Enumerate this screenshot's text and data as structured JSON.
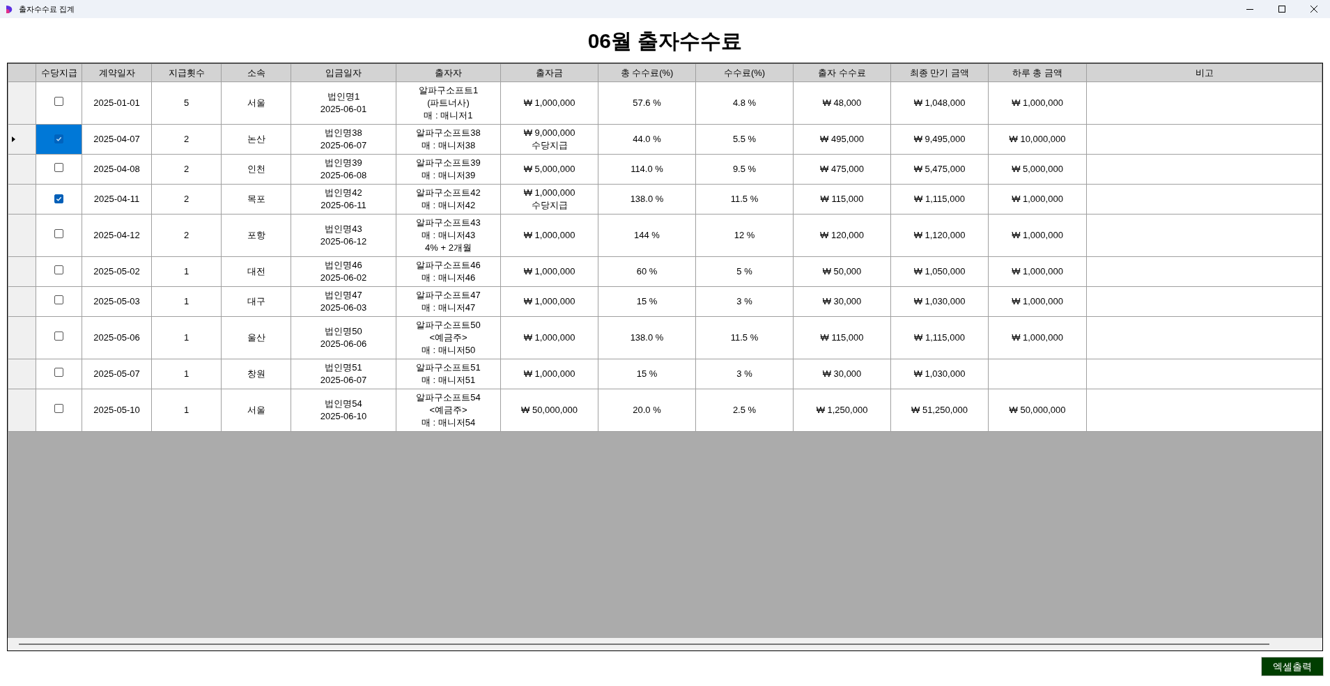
{
  "window": {
    "title": "출자수수료 집계"
  },
  "heading": "06월 출자수수료",
  "table": {
    "columns": [
      "수당지급",
      "계약일자",
      "지급횟수",
      "소속",
      "입금일자",
      "출자자",
      "출자금",
      "총 수수료(%)",
      "수수료(%)",
      "출자 수수료",
      "최종 만기 금액",
      "하루 총 금액",
      "비고"
    ],
    "rows": [
      {
        "selected": false,
        "checked": false,
        "contract_date": "2025-01-01",
        "count": "5",
        "branch": "서울",
        "deposit": "법인명1\n2025-06-01",
        "investor": "알파구소프트1\n(파트너사)\n매 : 매니저1",
        "amount": "₩ 1,000,000",
        "total_fee": "57.6 %",
        "fee": "4.8 %",
        "invest_fee": "₩ 48,000",
        "final_amount": "₩ 1,048,000",
        "daily_total": "₩ 1,000,000"
      },
      {
        "selected": true,
        "checked": true,
        "contract_date": "2025-04-07",
        "count": "2",
        "branch": "논산",
        "deposit": "법인명38\n2025-06-07",
        "investor": "알파구소프트38\n매 : 매니저38",
        "amount": "₩ 9,000,000\n수당지급",
        "total_fee": "44.0 %",
        "fee": "5.5 %",
        "invest_fee": "₩ 495,000",
        "final_amount": "₩ 9,495,000",
        "daily_total": "₩ 10,000,000"
      },
      {
        "selected": false,
        "checked": false,
        "contract_date": "2025-04-08",
        "count": "2",
        "branch": "인천",
        "deposit": "법인명39\n2025-06-08",
        "investor": "알파구소프트39\n매 : 매니저39",
        "amount": "₩ 5,000,000",
        "total_fee": "114.0 %",
        "fee": "9.5 %",
        "invest_fee": "₩ 475,000",
        "final_amount": "₩ 5,475,000",
        "daily_total": "₩ 5,000,000"
      },
      {
        "selected": false,
        "checked": true,
        "contract_date": "2025-04-11",
        "count": "2",
        "branch": "목포",
        "deposit": "법인명42\n2025-06-11",
        "investor": "알파구소프트42\n매 : 매니저42",
        "amount": "₩ 1,000,000\n수당지급",
        "total_fee": "138.0 %",
        "fee": "11.5 %",
        "invest_fee": "₩ 115,000",
        "final_amount": "₩ 1,115,000",
        "daily_total": "₩ 1,000,000"
      },
      {
        "selected": false,
        "checked": false,
        "contract_date": "2025-04-12",
        "count": "2",
        "branch": "포항",
        "deposit": "법인명43\n2025-06-12",
        "investor": "알파구소프트43\n매 : 매니저43\n4% + 2개월",
        "amount": "₩ 1,000,000",
        "total_fee": "144 %",
        "fee": "12 %",
        "invest_fee": "₩ 120,000",
        "final_amount": "₩ 1,120,000",
        "daily_total": "₩ 1,000,000"
      },
      {
        "selected": false,
        "checked": false,
        "contract_date": "2025-05-02",
        "count": "1",
        "branch": "대전",
        "deposit": "법인명46\n2025-06-02",
        "investor": "알파구소프트46\n매 : 매니저46",
        "amount": "₩ 1,000,000",
        "total_fee": "60 %",
        "fee": "5 %",
        "invest_fee": "₩ 50,000",
        "final_amount": "₩ 1,050,000",
        "daily_total": "₩ 1,000,000"
      },
      {
        "selected": false,
        "checked": false,
        "contract_date": "2025-05-03",
        "count": "1",
        "branch": "대구",
        "deposit": "법인명47\n2025-06-03",
        "investor": "알파구소프트47\n매 : 매니저47",
        "amount": "₩ 1,000,000",
        "total_fee": "15 %",
        "fee": "3 %",
        "invest_fee": "₩ 30,000",
        "final_amount": "₩ 1,030,000",
        "daily_total": "₩ 1,000,000"
      },
      {
        "selected": false,
        "checked": false,
        "contract_date": "2025-05-06",
        "count": "1",
        "branch": "울산",
        "deposit": "법인명50\n2025-06-06",
        "investor": "알파구소프트50\n<예금주>\n매 : 매니저50",
        "amount": "₩ 1,000,000",
        "total_fee": "138.0 %",
        "fee": "11.5 %",
        "invest_fee": "₩ 115,000",
        "final_amount": "₩ 1,115,000",
        "daily_total": "₩ 1,000,000"
      },
      {
        "selected": false,
        "checked": false,
        "contract_date": "2025-05-07",
        "count": "1",
        "branch": "창원",
        "deposit": "법인명51\n2025-06-07",
        "investor": "알파구소프트51\n매 : 매니저51",
        "amount": "₩ 1,000,000",
        "total_fee": "15 %",
        "fee": "3 %",
        "invest_fee": "₩ 30,000",
        "final_amount": "₩ 1,030,000"
      },
      {
        "selected": false,
        "checked": false,
        "contract_date": "2025-05-10",
        "count": "1",
        "branch": "서울",
        "deposit": "법인명54\n2025-06-10",
        "investor": "알파구소프트54\n<예금주>\n매 : 매니저54",
        "amount": "₩ 50,000,000",
        "total_fee": "20.0 %",
        "fee": "2.5 %",
        "invest_fee": "₩ 1,250,000",
        "final_amount": "₩ 51,250,000",
        "daily_total": "₩ 50,000,000"
      }
    ]
  },
  "export_button": "엑셀출력"
}
